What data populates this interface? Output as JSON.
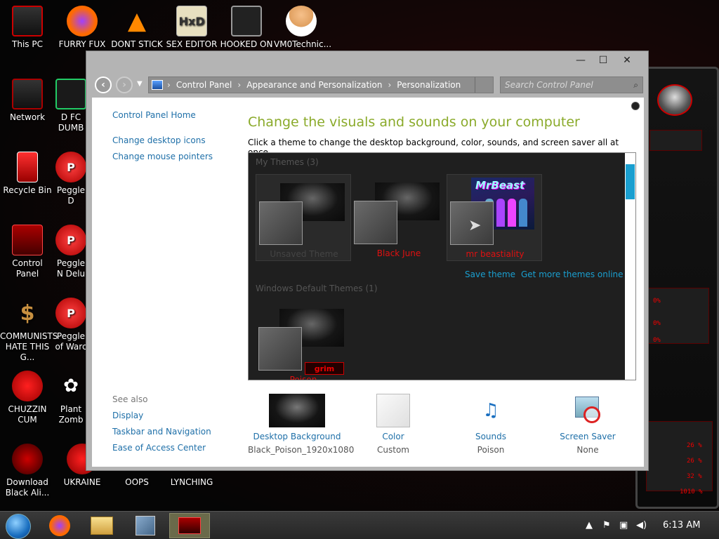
{
  "desktop": {
    "icons": [
      {
        "label": "This PC"
      },
      {
        "label": "FURRY FUX"
      },
      {
        "label": "DONT STICK"
      },
      {
        "label": "SEX EDITOR"
      },
      {
        "label": "HOOKED ON"
      },
      {
        "label": "VM0Technic..."
      },
      {
        "label": "Network"
      },
      {
        "label": "D FC DUMB"
      },
      {
        "label": "Recycle Bin"
      },
      {
        "label": "Peggle D"
      },
      {
        "label": "Control Panel"
      },
      {
        "label": "Peggle N Delu"
      },
      {
        "label": "COMMUNISTS HATE THIS G..."
      },
      {
        "label": "Peggle of Warc"
      },
      {
        "label": "CHUZZIN CUM"
      },
      {
        "label": "Plant Zomb"
      },
      {
        "label": "Download Black Ali..."
      },
      {
        "label": "UKRAINE"
      },
      {
        "label": "OOPS"
      },
      {
        "label": "LYNCHING"
      }
    ],
    "deco_readouts": [
      "0%",
      "0%",
      "0%",
      "26 %",
      "26 %",
      "32 %",
      "1010 %"
    ]
  },
  "window": {
    "controls": {
      "minimize": "—",
      "maximize": "☐",
      "close": "✕"
    },
    "breadcrumb": [
      "Control Panel",
      "Appearance and Personalization",
      "Personalization"
    ],
    "search_placeholder": "Search Control Panel",
    "left_nav": {
      "home": "Control Panel Home",
      "links": [
        "Change desktop icons",
        "Change mouse pointers"
      ],
      "see_also_title": "See also",
      "see_also": [
        "Display",
        "Taskbar and Navigation",
        "Ease of Access Center"
      ]
    },
    "title": "Change the visuals and sounds on your computer",
    "description": "Click a theme to change the desktop background, color, sounds, and screen saver all at once.",
    "themes": {
      "my_themes_title": "My Themes (3)",
      "my_themes": [
        {
          "name": "Unsaved Theme",
          "color": "#444444"
        },
        {
          "name": "Black June",
          "color": "#e01010"
        },
        {
          "name": "mr beastiality",
          "color": "#e01010",
          "thumb_text": "MrBeast"
        }
      ],
      "save_theme": "Save theme",
      "get_more": "Get more themes online",
      "default_title": "Windows Default Themes (1)",
      "default_themes": [
        {
          "name": "Poison",
          "badge": "grim"
        }
      ]
    },
    "settings": [
      {
        "label": "Desktop Background",
        "value": "Black_Poison_1920x1080"
      },
      {
        "label": "Color",
        "value": "Custom"
      },
      {
        "label": "Sounds",
        "value": "Poison"
      },
      {
        "label": "Screen Saver",
        "value": "None"
      }
    ]
  },
  "taskbar": {
    "clock": "6:13 AM"
  }
}
